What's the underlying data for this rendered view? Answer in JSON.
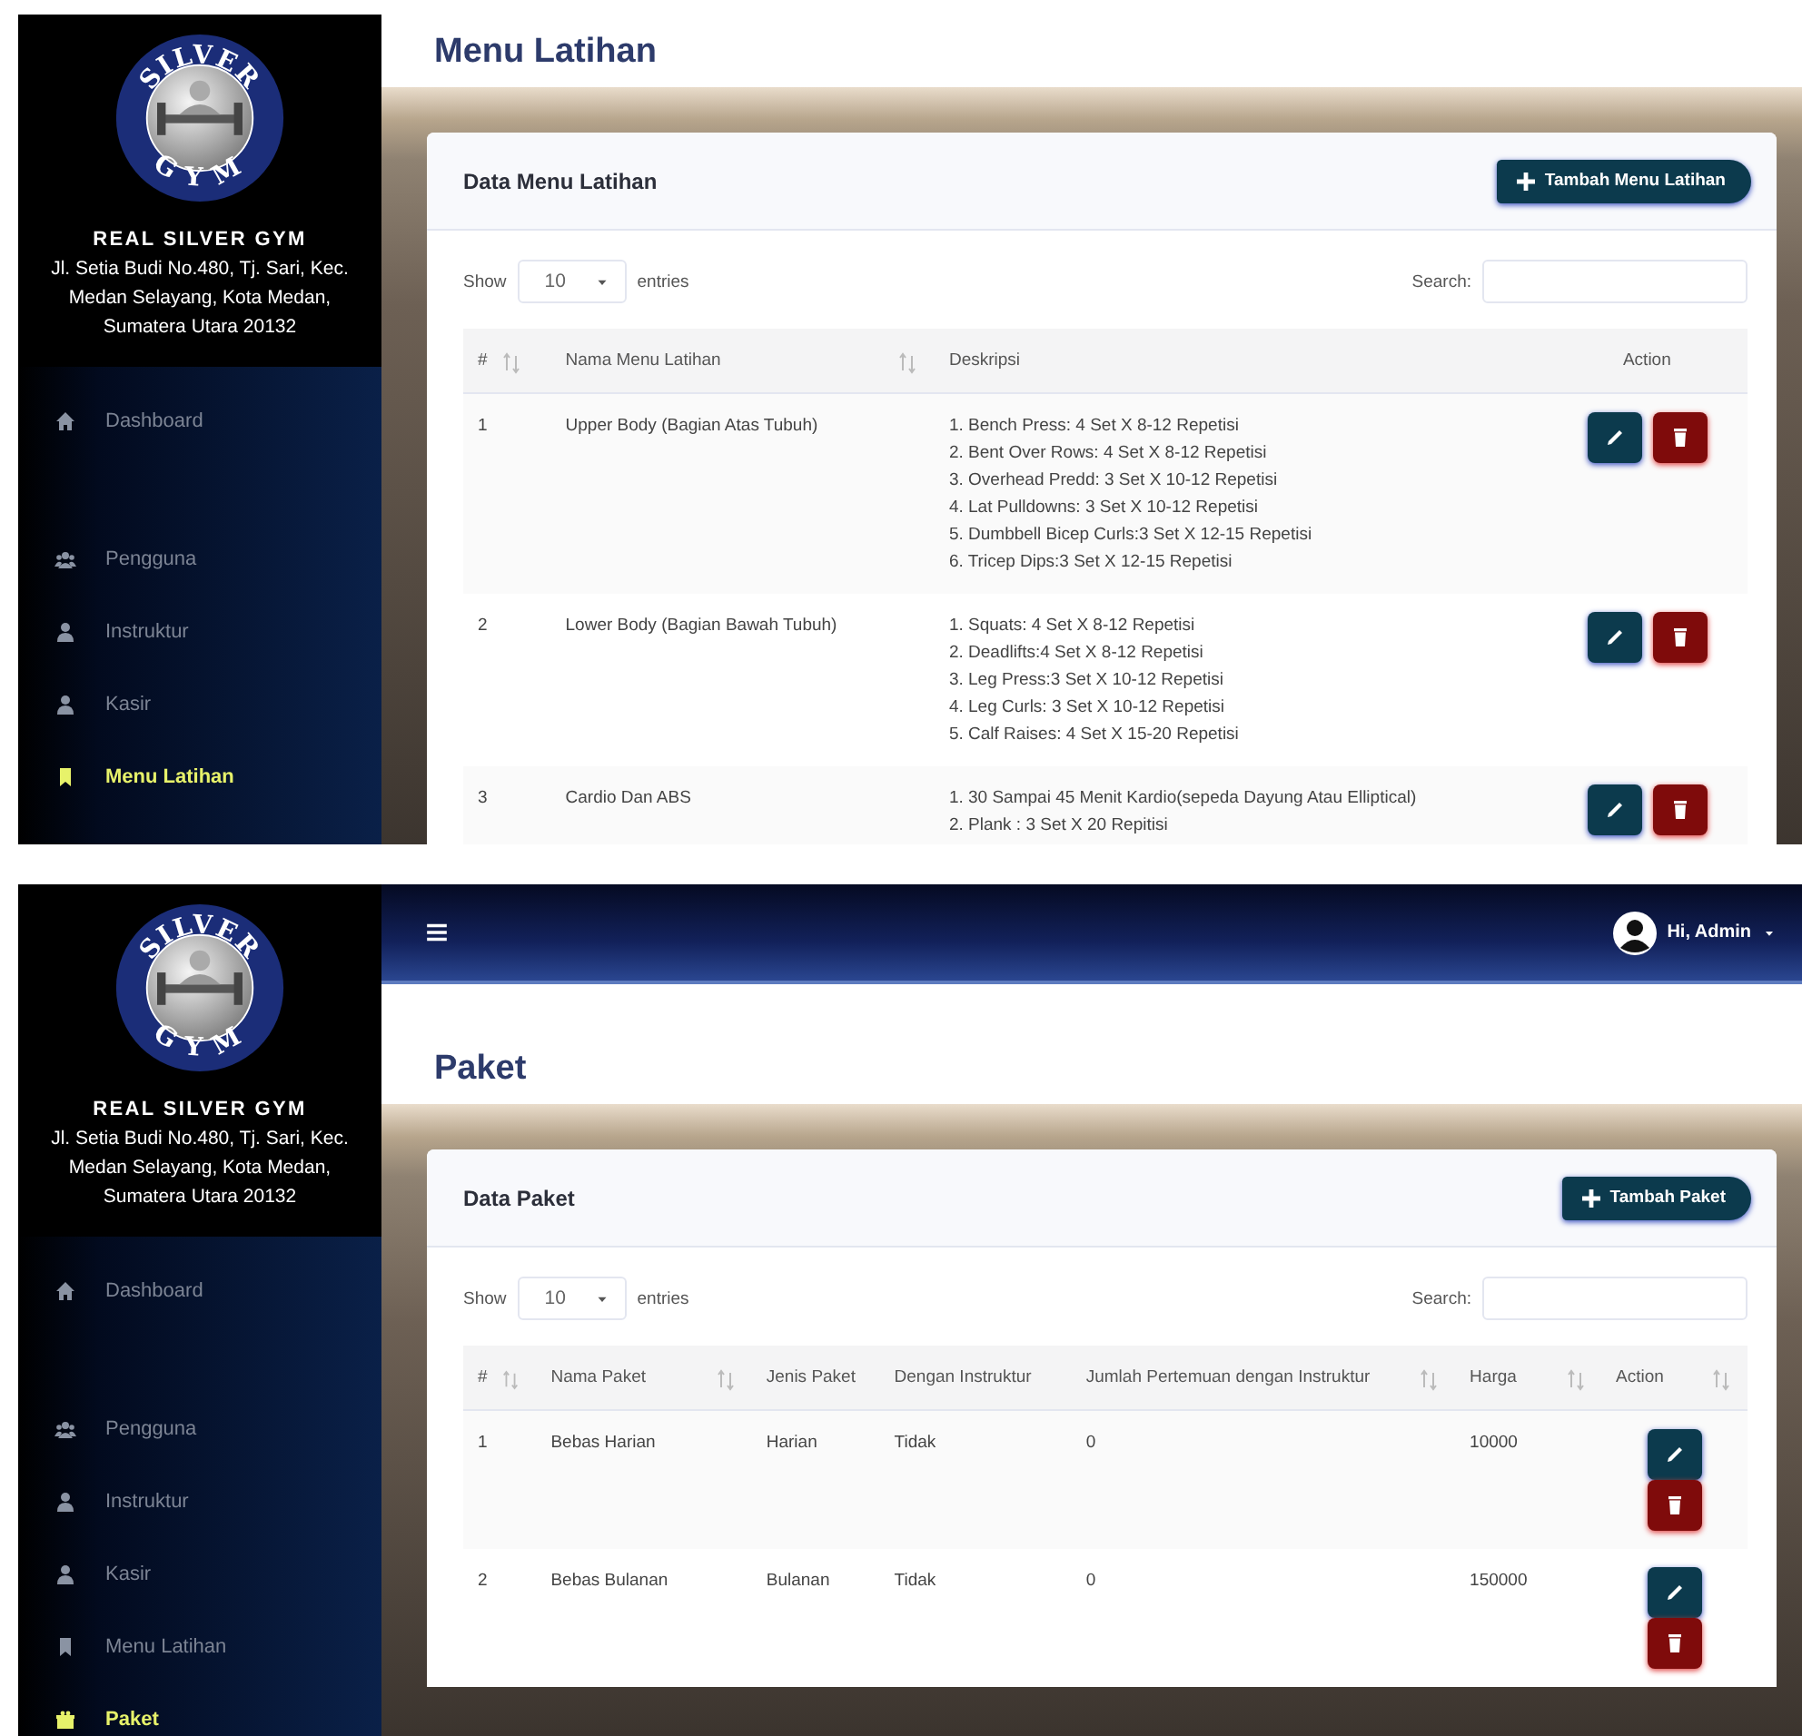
{
  "screens": [
    {
      "kind": "menu",
      "sidebar": {
        "logo_top": "SILVER",
        "logo_bottom": "GYM",
        "brand": "REAL SILVER GYM",
        "address": "Jl. Setia Budi No.480, Tj. Sari, Kec. Medan Selayang, Kota Medan, Sumatera Utara 20132",
        "items": [
          {
            "label": "Dashboard",
            "selected": false
          },
          {
            "label": "Pengguna",
            "selected": false
          },
          {
            "label": "Instruktur",
            "selected": false
          },
          {
            "label": "Kasir",
            "selected": false
          },
          {
            "label": "Menu Latihan",
            "selected": true
          }
        ]
      },
      "page_title": "Menu Latihan",
      "card": {
        "title": "Data Menu Latihan",
        "add_button": "Tambah Menu Latihan",
        "show_label": "Show",
        "entries_value": "10",
        "entries_label": "entries",
        "search_label": "Search:",
        "columns": [
          {
            "label": "#",
            "kind": "text",
            "sortable": true
          },
          {
            "label": "Nama Menu Latihan",
            "kind": "text",
            "sortable": true
          },
          {
            "label": "Deskripsi",
            "kind": "text",
            "sortable": false
          },
          {
            "label": "Action",
            "kind": "action",
            "sortable": false
          }
        ],
        "rows": [
          {
            "cells": [
              "1",
              "Upper Body (Bagian Atas Tubuh)",
              [
                "1. Bench Press: 4 Set X 8-12 Repetisi",
                "2. Bent Over Rows: 4 Set X 8-12 Repetisi",
                "3. Overhead Predd: 3 Set X 10-12 Repetisi",
                "4. Lat Pulldowns: 3 Set X 10-12 Repetisi",
                "5. Dumbbell Bicep Curls:3 Set X 12-15 Repetisi",
                "6. Tricep Dips:3 Set X 12-15 Repetisi"
              ]
            ]
          },
          {
            "cells": [
              "2",
              "Lower Body (Bagian Bawah Tubuh)",
              [
                "1. Squats: 4 Set X 8-12 Repetisi",
                "2. Deadlifts:4 Set X 8-12 Repetisi",
                "3. Leg Press:3 Set X 10-12 Repetisi",
                "4. Leg Curls: 3 Set X 10-12 Repetisi",
                "5. Calf Raises: 4 Set X 15-20 Repetisi"
              ]
            ]
          },
          {
            "cells": [
              "3",
              "Cardio Dan ABS",
              [
                "1. 30 Sampai 45 Menit Kardio(sepeda Dayung Atau Elliptical)",
                "2. Plank : 3 Set X 20 Repitisi"
              ]
            ]
          }
        ]
      }
    },
    {
      "kind": "paket",
      "navbar": {
        "user": "Hi, Admin"
      },
      "sidebar": {
        "logo_top": "SILVER",
        "logo_bottom": "GYM",
        "brand": "REAL SILVER GYM",
        "address": "Jl. Setia Budi No.480, Tj. Sari, Kec. Medan Selayang, Kota Medan, Sumatera Utara 20132",
        "items": [
          {
            "label": "Dashboard",
            "selected": false
          },
          {
            "label": "Pengguna",
            "selected": false
          },
          {
            "label": "Instruktur",
            "selected": false
          },
          {
            "label": "Kasir",
            "selected": false
          },
          {
            "label": "Menu Latihan",
            "selected": false
          },
          {
            "label": "Paket",
            "selected": true
          }
        ]
      },
      "page_title": "Paket",
      "card": {
        "title": "Data Paket",
        "add_button": "Tambah Paket",
        "show_label": "Show",
        "entries_value": "10",
        "entries_label": "entries",
        "search_label": "Search:",
        "columns": [
          {
            "label": "#",
            "kind": "text",
            "sortable": true
          },
          {
            "label": "Nama Paket",
            "kind": "text",
            "sortable": true
          },
          {
            "label": "Jenis Paket",
            "kind": "text",
            "sortable": false
          },
          {
            "label": "Dengan Instruktur",
            "kind": "text",
            "sortable": false
          },
          {
            "label": "Jumlah Pertemuan dengan Instruktur",
            "kind": "text",
            "sortable": true
          },
          {
            "label": "Harga",
            "kind": "text",
            "sortable": true
          },
          {
            "label": "Action",
            "kind": "action",
            "sortable": true
          }
        ],
        "rows": [
          {
            "cells": [
              "1",
              "Bebas Harian",
              "Harian",
              "Tidak",
              "0",
              "10000"
            ]
          },
          {
            "cells": [
              "2",
              "Bebas Bulanan",
              "Bulanan",
              "Tidak",
              "0",
              "150000"
            ]
          }
        ]
      }
    }
  ]
}
